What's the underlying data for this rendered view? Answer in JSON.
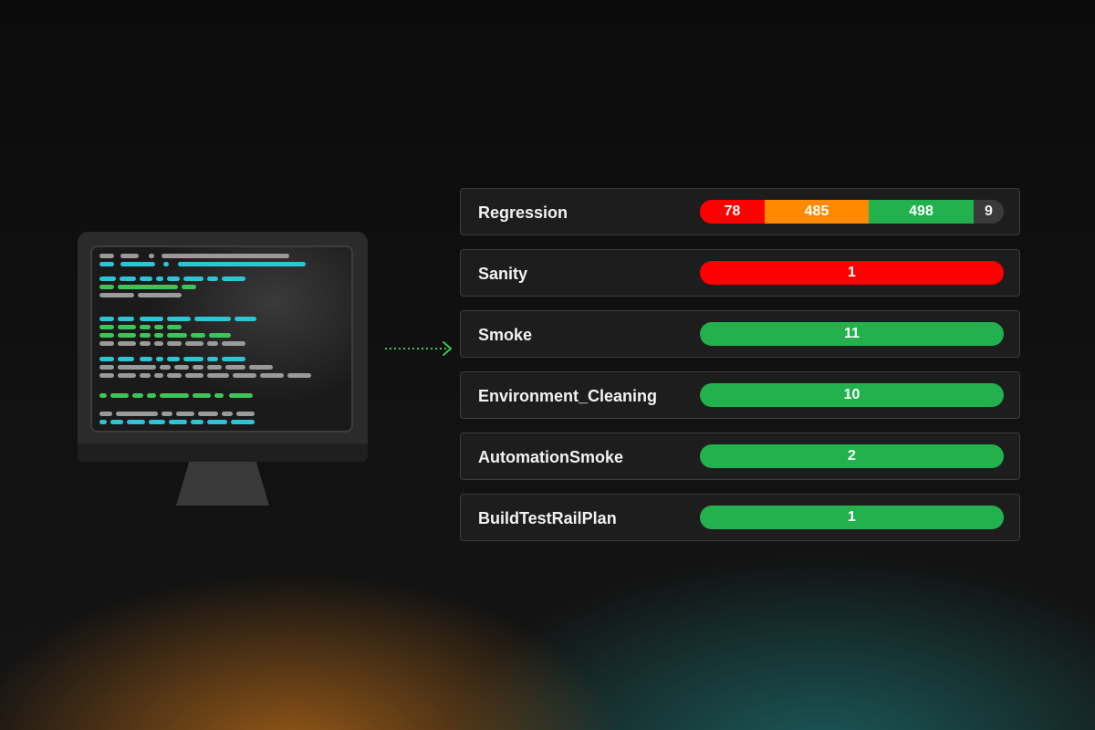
{
  "colors": {
    "failed": "#ff0000",
    "warning": "#ff8a00",
    "passed": "#22b14c",
    "other": "#3a3a3a",
    "arrow": "#3fc45a"
  },
  "icons": {
    "monitor": "desktop-monitor-icon",
    "arrow": "dotted-arrow-right-icon"
  },
  "suites": [
    {
      "label": "Regression",
      "segments": [
        {
          "value": "78",
          "status": "failed"
        },
        {
          "value": "485",
          "status": "warning"
        },
        {
          "value": "498",
          "status": "passed"
        },
        {
          "value": "9",
          "status": "other"
        }
      ]
    },
    {
      "label": "Sanity",
      "segments": [
        {
          "value": "1",
          "status": "failed"
        }
      ]
    },
    {
      "label": "Smoke",
      "segments": [
        {
          "value": "11",
          "status": "passed"
        }
      ]
    },
    {
      "label": "Environment_Cleaning",
      "segments": [
        {
          "value": "10",
          "status": "passed"
        }
      ]
    },
    {
      "label": "AutomationSmoke",
      "segments": [
        {
          "value": "2",
          "status": "passed"
        }
      ]
    },
    {
      "label": "BuildTestRailPlan",
      "segments": [
        {
          "value": "1",
          "status": "passed"
        }
      ]
    }
  ]
}
